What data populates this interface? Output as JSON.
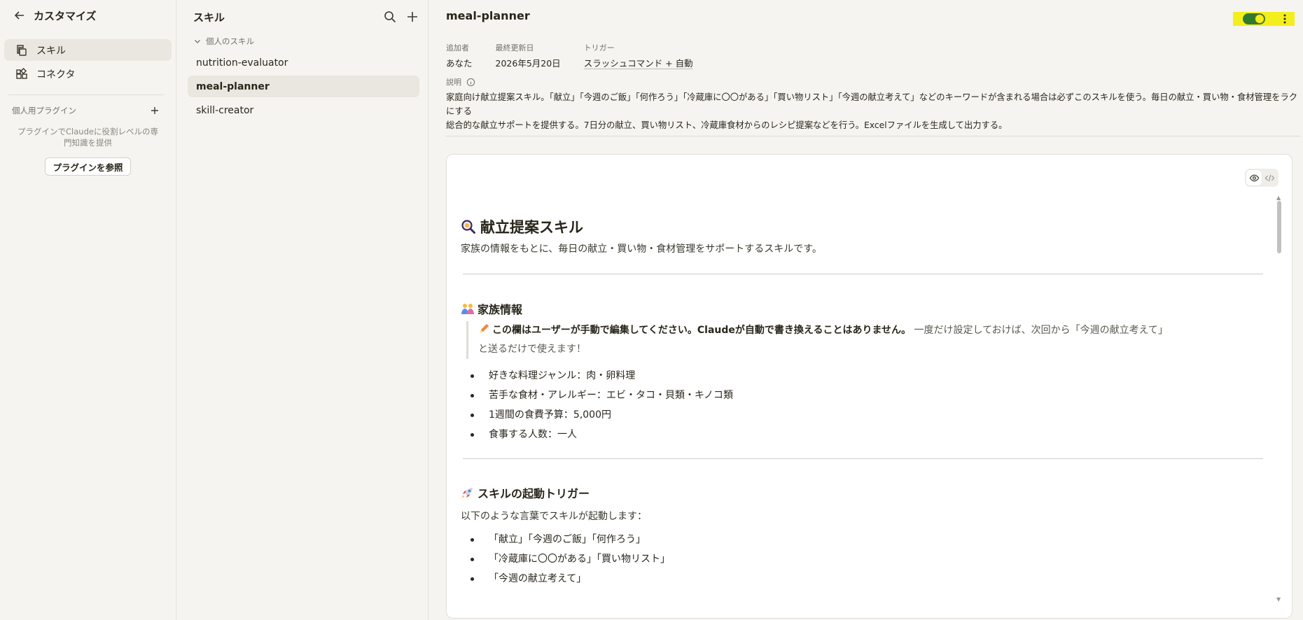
{
  "sidebar": {
    "title": "カスタマイズ",
    "nav": [
      {
        "label": "スキル",
        "icon": "skills-icon",
        "active": true
      },
      {
        "label": "コネクタ",
        "icon": "connector-icon",
        "active": false
      }
    ],
    "plugins_title": "個人用プラグイン",
    "plugins_description": "プラグインでClaudeに役割レベルの専門知識を提供",
    "browse_button": "プラグインを参照"
  },
  "skills_panel": {
    "title": "スキル",
    "group_label": "個人のスキル",
    "items": [
      {
        "label": "nutrition-evaluator",
        "active": false
      },
      {
        "label": "meal-planner",
        "active": true
      },
      {
        "label": "skill-creator",
        "active": false
      }
    ]
  },
  "detail": {
    "title": "meal-planner",
    "toggle_enabled": true,
    "accent_highlight": "#f4ee1c",
    "meta": {
      "added_by_label": "追加者",
      "added_by_value": "あなた",
      "updated_label": "最終更新日",
      "updated_value": "2026年5月20日",
      "trigger_label": "トリガー",
      "trigger_value": "スラッシュコマンド + 自動"
    },
    "description_label": "説明",
    "description_line1": "家庭向け献立提案スキル。「献立」「今週のご飯」「何作ろう」「冷蔵庫に〇〇がある」「買い物リスト」「今週の献立考えて」などのキーワードが含まれる場合は必ずこのスキルを使う。毎日の献立・買い物・食材管理をラクにする",
    "description_line2": "総合的な献立サポートを提供する。7日分の献立、買い物リスト、冷蔵庫食材からのレシピ提案などを行う。Excelファイルを生成して出力する。"
  },
  "document": {
    "h1": "献立提案スキル",
    "h1_icon": "magnifier-emoji-icon",
    "lead": "家族の情報をもとに、毎日の献立・買い物・食材管理をサポートするスキルです。",
    "family": {
      "heading": "家族情報",
      "icon": "family-emoji-icon",
      "quote_bold": "この欄はユーザーが手動で編集してください。Claudeが自動で書き換えることはありません。",
      "quote_rest_1": " 一度だけ設定しておけば、次回から「今週の献立考えて」",
      "quote_rest_2": "と送るだけで使えます！",
      "items": [
        "好きな料理ジャンル：肉・卵料理",
        "苦手な食材・アレルギー：エビ・タコ・貝類・キノコ類",
        "1週間の食費予算：5,000円",
        "食事する人数：一人"
      ]
    },
    "trigger": {
      "heading": "スキルの起動トリガー",
      "icon": "rocket-emoji-icon",
      "intro": "以下のような言葉でスキルが起動します：",
      "items": [
        "「献立」「今週のご飯」「何作ろう」",
        "「冷蔵庫に〇〇がある」「買い物リスト」",
        "「今週の献立考えて」"
      ]
    }
  }
}
